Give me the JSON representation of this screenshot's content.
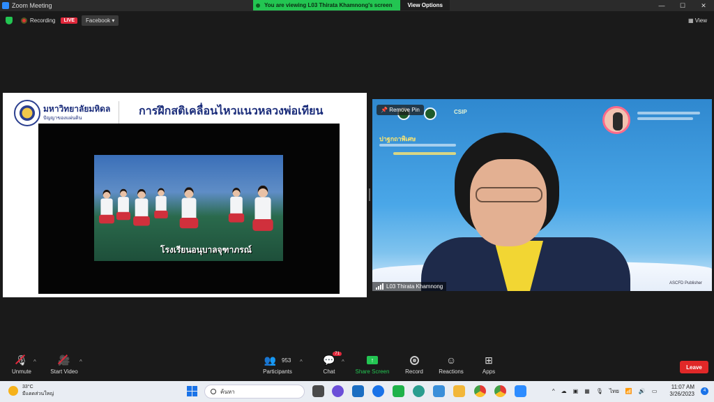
{
  "window": {
    "title": "Zoom Meeting"
  },
  "banner": {
    "message": "You are viewing L03 Thirata Khamnong's screen",
    "view_options": "View Options"
  },
  "window_controls": {
    "minimize": "—",
    "maximize": "☐",
    "close": "✕"
  },
  "topbar": {
    "recording": "Recording",
    "live": "LIVE",
    "facebook": "Facebook ▾",
    "view": "View"
  },
  "shared_screen": {
    "university": "มหาวิทยาลัยมหิดล",
    "university_sub": "ปัญญาของแผ่นดิน",
    "slide_title": "การฝึกสติเคลื่อนไหวแนวหลวงพ่อเทียน",
    "video_caption": "โรงเรียนอนุบาลจุฑาภรณ์"
  },
  "speaker": {
    "remove_pin": "Remove Pin",
    "name": "L03 Thirata Khamnong",
    "bg_brand": "CSIP",
    "bg_heading": "ปาฐกถาพิเศษ",
    "bg_footer": "ASCFD Publisher"
  },
  "toolbar": {
    "unmute": "Unmute",
    "start_video": "Start Video",
    "participants": "Participants",
    "participants_count": "953",
    "chat": "Chat",
    "chat_badge": "71",
    "share_screen": "Share Screen",
    "record": "Record",
    "reactions": "Reactions",
    "apps": "Apps",
    "leave": "Leave"
  },
  "taskbar": {
    "weather_temp": "33°C",
    "weather_desc": "มีแดดส่วนใหญ่",
    "search": "ค้นหา",
    "lang": "ไทย",
    "time": "11:07 AM",
    "date": "3/26/2023",
    "notifications": "4"
  },
  "colors": {
    "accent_green": "#23c552",
    "live_red": "#e0283b",
    "leave_red": "#e02828"
  }
}
